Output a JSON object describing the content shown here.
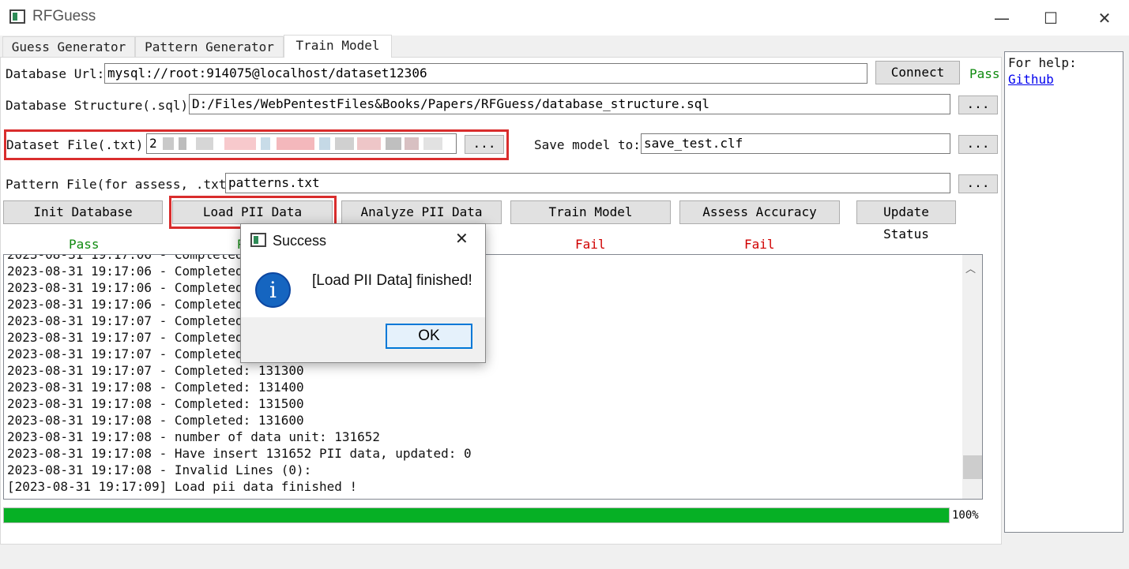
{
  "window": {
    "title": "RFGuess",
    "minimize": "—",
    "maximize": "☐",
    "close": "✕"
  },
  "tabs": [
    {
      "label": "Guess Generator"
    },
    {
      "label": "Pattern Generator"
    },
    {
      "label": "Train Model"
    }
  ],
  "form": {
    "db_url_label": "Database Url:",
    "db_url_value": "mysql://root:914075@localhost/dataset12306",
    "connect_label": "Connect",
    "connect_status": "Pass",
    "db_structure_label": "Database Structure(.sql):",
    "db_structure_value": "D:/Files/WebPentestFiles&Books/Papers/RFGuess/database_structure.sql",
    "browse_label": "...",
    "dataset_label": "Dataset File(.txt):",
    "dataset_value": "2",
    "save_model_label": "Save model to:",
    "save_model_value": "save_test.clf",
    "pattern_label": "Pattern File(for assess, .txt)",
    "pattern_value": "patterns.txt"
  },
  "actions": [
    {
      "label": "Init Database",
      "status": "Pass"
    },
    {
      "label": "Load PII Data",
      "status": "P"
    },
    {
      "label": "Analyze PII Data",
      "status": ""
    },
    {
      "label": "Train Model",
      "status": "Fail"
    },
    {
      "label": "Assess Accuracy",
      "status": "Fail"
    },
    {
      "label": "Update Status",
      "status": ""
    }
  ],
  "colors": {
    "pass": "#0f8a0f",
    "fail": "#d00000",
    "progress": "#06b025",
    "highlight": "#d92d2d",
    "link": "#0000ee"
  },
  "log": {
    "top_partial": "2023-08-31 19:17:06 - Completed:",
    "lines": [
      "2023-08-31 19:17:06 - Completed:",
      "2023-08-31 19:17:06 - Completed:",
      "2023-08-31 19:17:06 - Completed:",
      "2023-08-31 19:17:07 - Completed:",
      "2023-08-31 19:17:07 - Completed:",
      "2023-08-31 19:17:07 - Completed:",
      "2023-08-31 19:17:07 - Completed: 131300",
      "2023-08-31 19:17:08 - Completed: 131400",
      "2023-08-31 19:17:08 - Completed: 131500",
      "2023-08-31 19:17:08 - Completed: 131600",
      "2023-08-31 19:17:08 - number of data unit: 131652",
      "2023-08-31 19:17:08 - Have insert 131652 PII data, updated: 0",
      "2023-08-31 19:17:08 - Invalid Lines (0):",
      "[2023-08-31 19:17:09] Load pii data finished !"
    ]
  },
  "progress": {
    "value": 1.0,
    "label": "100%"
  },
  "help": {
    "text": "For help:",
    "link": "Github"
  },
  "dialog": {
    "title": "Success",
    "message": "[Load PII Data] finished!",
    "ok_label": "OK",
    "close": "✕"
  }
}
